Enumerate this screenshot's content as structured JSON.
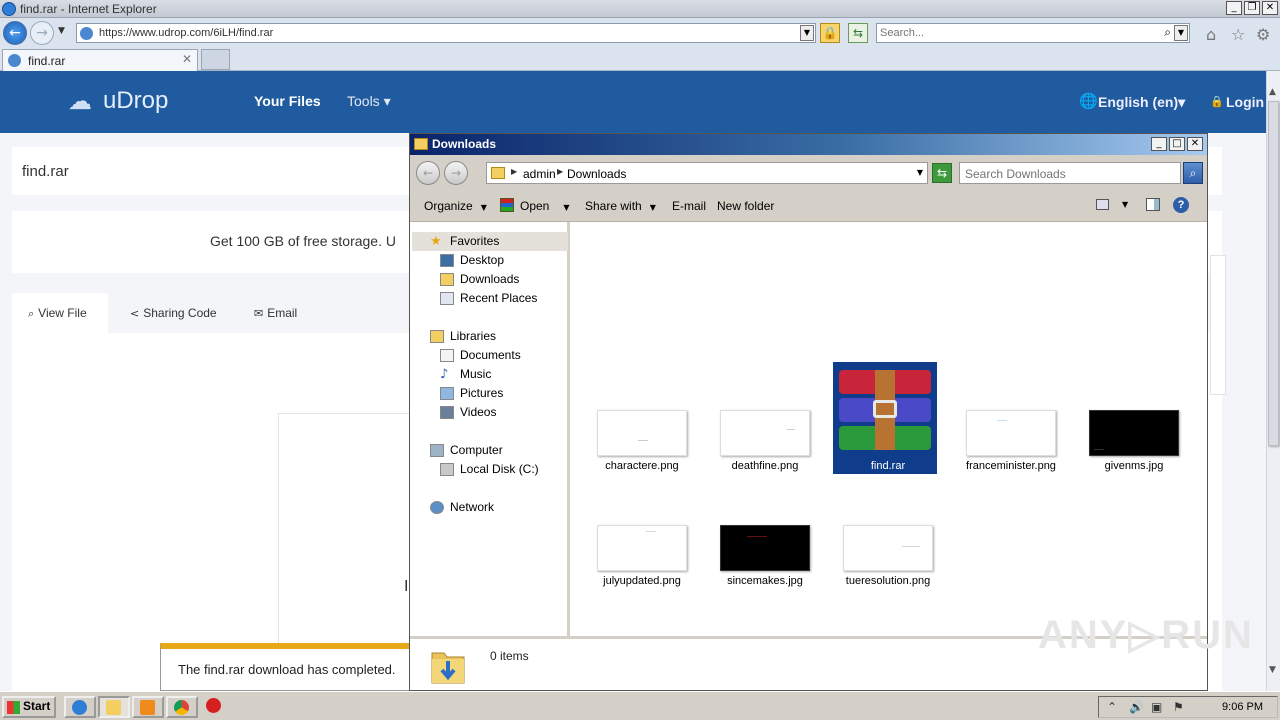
{
  "ie": {
    "title": "find.rar - Internet Explorer",
    "url": "https://www.udrop.com/6iLH/find.rar",
    "search_placeholder": "Search...",
    "tab_label": "find.rar"
  },
  "site": {
    "logo": "uDrop",
    "nav_files": "Your Files",
    "nav_tools": "Tools ▾",
    "language": "English (en)▾",
    "login": "Login",
    "file_title": "find.rar",
    "promo": "Get 100 GB of free storage. U",
    "tabs": {
      "view": "View File",
      "share": "Sharing Code",
      "email": "Email"
    },
    "preview_glyph": "I"
  },
  "notification": {
    "text": "The find.rar download has completed.",
    "accent_color": "#e6a817"
  },
  "explorer": {
    "title": "Downloads",
    "crumbs": [
      "admin",
      "Downloads"
    ],
    "search_placeholder": "Search Downloads",
    "commands": {
      "organize": "Organize",
      "open": "Open",
      "share": "Share with",
      "email": "E-mail",
      "new_folder": "New folder"
    },
    "nav": {
      "favorites": "Favorites",
      "desktop": "Desktop",
      "downloads": "Downloads",
      "recent": "Recent Places",
      "libraries": "Libraries",
      "documents": "Documents",
      "music": "Music",
      "pictures": "Pictures",
      "videos": "Videos",
      "computer": "Computer",
      "local_disk": "Local Disk (C:)",
      "network": "Network"
    },
    "files": [
      {
        "name": "charactere.png",
        "kind": "light"
      },
      {
        "name": "deathfine.png",
        "kind": "light"
      },
      {
        "name": "find.rar",
        "kind": "archive",
        "selected": true
      },
      {
        "name": "franceminister.png",
        "kind": "light"
      },
      {
        "name": "givenms.jpg",
        "kind": "dark"
      },
      {
        "name": "julyupdated.png",
        "kind": "light"
      },
      {
        "name": "sincemakes.jpg",
        "kind": "dark"
      },
      {
        "name": "tueresolution.png",
        "kind": "light"
      }
    ],
    "status": "0 items"
  },
  "watermark": "ANY▷RUN",
  "taskbar": {
    "start": "Start",
    "clock": "9:06 PM"
  },
  "colors": {
    "site_header": "#1f5b9e",
    "selection": "#0f3d8c",
    "titlebar": "#0a246a"
  }
}
